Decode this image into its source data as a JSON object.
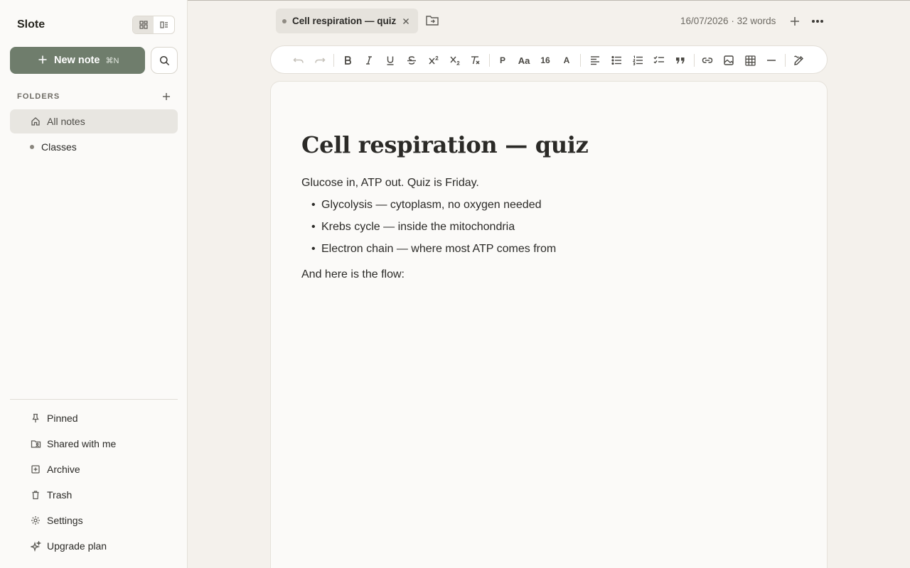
{
  "app": {
    "name": "Slote"
  },
  "sidebar": {
    "new_note_label": "New note",
    "new_note_shortcut": "⌘N",
    "folders_heading": "FOLDERS",
    "folders": [
      {
        "label": "All notes",
        "icon": "home-icon",
        "active": true
      },
      {
        "label": "Classes",
        "icon": "folder-dot",
        "active": false
      }
    ],
    "bottom": [
      {
        "label": "Pinned",
        "icon": "pin-icon"
      },
      {
        "label": "Shared with me",
        "icon": "shared-folder-icon"
      },
      {
        "label": "Archive",
        "icon": "archive-icon"
      },
      {
        "label": "Trash",
        "icon": "trash-icon"
      },
      {
        "label": "Settings",
        "icon": "gear-icon"
      },
      {
        "label": "Upgrade plan",
        "icon": "sparkle-icon"
      }
    ]
  },
  "tab": {
    "title": "Cell respiration — quiz"
  },
  "header": {
    "meta": "16/07/2026 · 32 words"
  },
  "toolbar": {
    "paragraph": "P",
    "font_case": "Aa",
    "font_size": "16",
    "text_color": "A"
  },
  "note": {
    "title": "Cell respiration — quiz",
    "intro": "Glucose in, ATP out. Quiz is Friday.",
    "bullets": [
      "Glycolysis — cytoplasm, no oxygen needed",
      "Krebs cycle — inside the mitochondria",
      "Electron chain — where most ATP comes from"
    ],
    "outro": "And here is the flow:"
  }
}
